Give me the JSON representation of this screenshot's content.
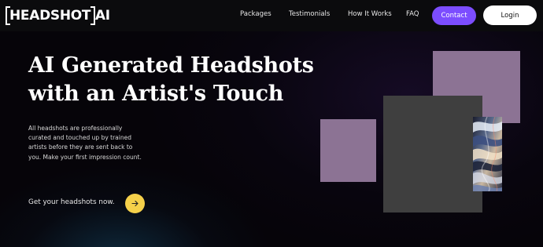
{
  "brand": {
    "logo_text": "HEADSHOT AI"
  },
  "nav": {
    "links": [
      {
        "label": "Packages"
      },
      {
        "label": "Testimonials"
      },
      {
        "label": "How It Works"
      },
      {
        "label": "FAQ"
      }
    ],
    "contact_label": "Contact",
    "login_label": "Login"
  },
  "hero": {
    "title_line1": "AI Generated Headshots",
    "title_line2": "with an Artist's Touch",
    "description": "All headshots are professionally curated and touched up by trained artists before they are sent back to you. Make your first impression count.",
    "cta_label": "Get your headshots now."
  },
  "colors": {
    "accent_purple": "#7c4dff",
    "cta_yellow": "#f5d04a",
    "tile_mauve": "#8c7394",
    "tile_gray": "#3f3f3f",
    "background": "#060409"
  },
  "icons": {
    "cta_icon": "arrow-right-icon",
    "collage_image": "abstract-chrome-image"
  }
}
